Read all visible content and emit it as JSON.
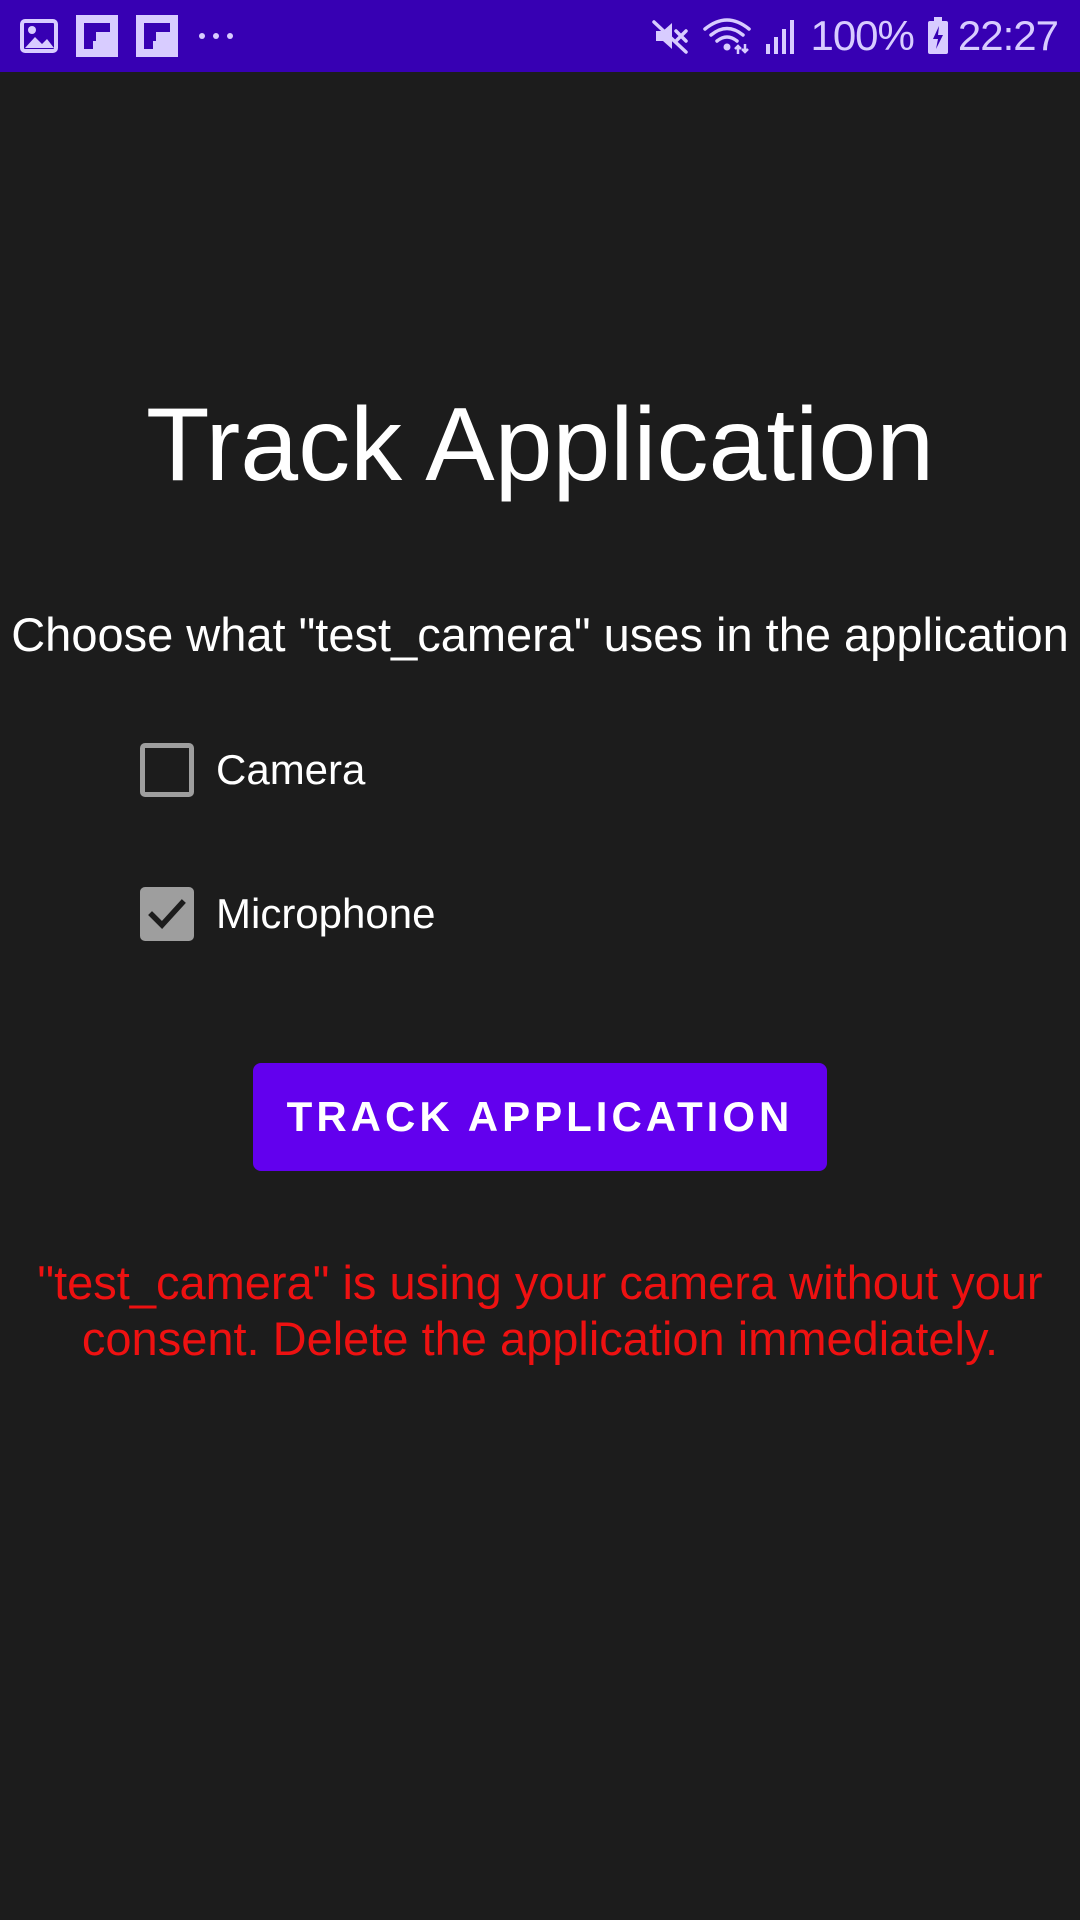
{
  "status_bar": {
    "battery": "100%",
    "time": "22:27",
    "left_icons": [
      "gallery-icon",
      "flipboard-icon",
      "flipboard-icon",
      "more-dots-icon"
    ],
    "right_icons": [
      "mute-icon",
      "wifi-icon",
      "signal-icon",
      "battery-charging-icon"
    ],
    "background": "#3700b3"
  },
  "main": {
    "title": "Track Application",
    "subtitle": "Choose what \"test_camera\" uses in the application",
    "options": [
      {
        "label": "Camera",
        "checked": false
      },
      {
        "label": "Microphone",
        "checked": true
      }
    ],
    "button_label": "TRACK APPLICATION",
    "warning": "\"test_camera\" is using your camera without your consent. Delete the application immediately."
  },
  "colors": {
    "background": "#1c1c1c",
    "accent": "#6200ee",
    "warning": "#ee1111",
    "checkbox": "#9e9e9e"
  }
}
